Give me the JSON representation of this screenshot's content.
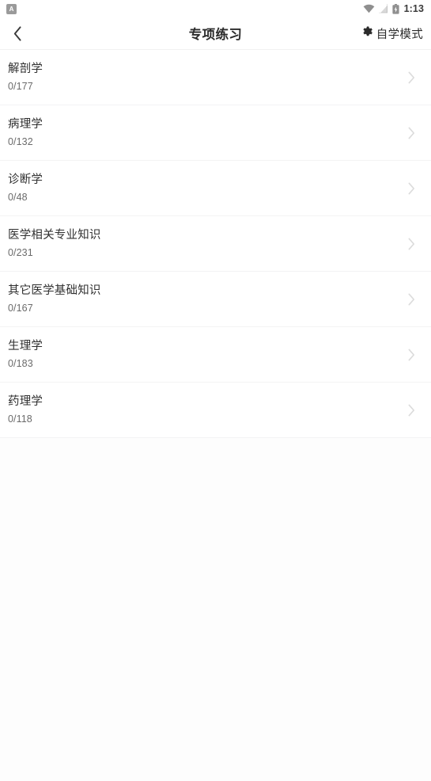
{
  "status_bar": {
    "app_badge_letter": "A",
    "icons": [
      "wifi-icon",
      "cellular-signal-off-icon",
      "battery-icon"
    ],
    "time": "1:13"
  },
  "header": {
    "back_icon": "chevron-left-icon",
    "title": "专项练习",
    "action": {
      "icon": "gear-icon",
      "label": "自学模式"
    }
  },
  "colors": {
    "background": "#fdfdfd",
    "surface": "#ffffff",
    "title_text": "#2b2b2b",
    "item_title_text": "#313131",
    "item_sub_text": "#6b6b6b",
    "divider": "#f3f3f4",
    "chevron": "#dcdcdc"
  },
  "list": {
    "chevron_icon": "chevron-right-icon",
    "items": [
      {
        "title": "解剖学",
        "progress": "0/177"
      },
      {
        "title": "病理学",
        "progress": "0/132"
      },
      {
        "title": "诊断学",
        "progress": "0/48"
      },
      {
        "title": "医学相关专业知识",
        "progress": "0/231"
      },
      {
        "title": "其它医学基础知识",
        "progress": "0/167"
      },
      {
        "title": "生理学",
        "progress": "0/183"
      },
      {
        "title": "药理学",
        "progress": "0/118"
      }
    ]
  }
}
